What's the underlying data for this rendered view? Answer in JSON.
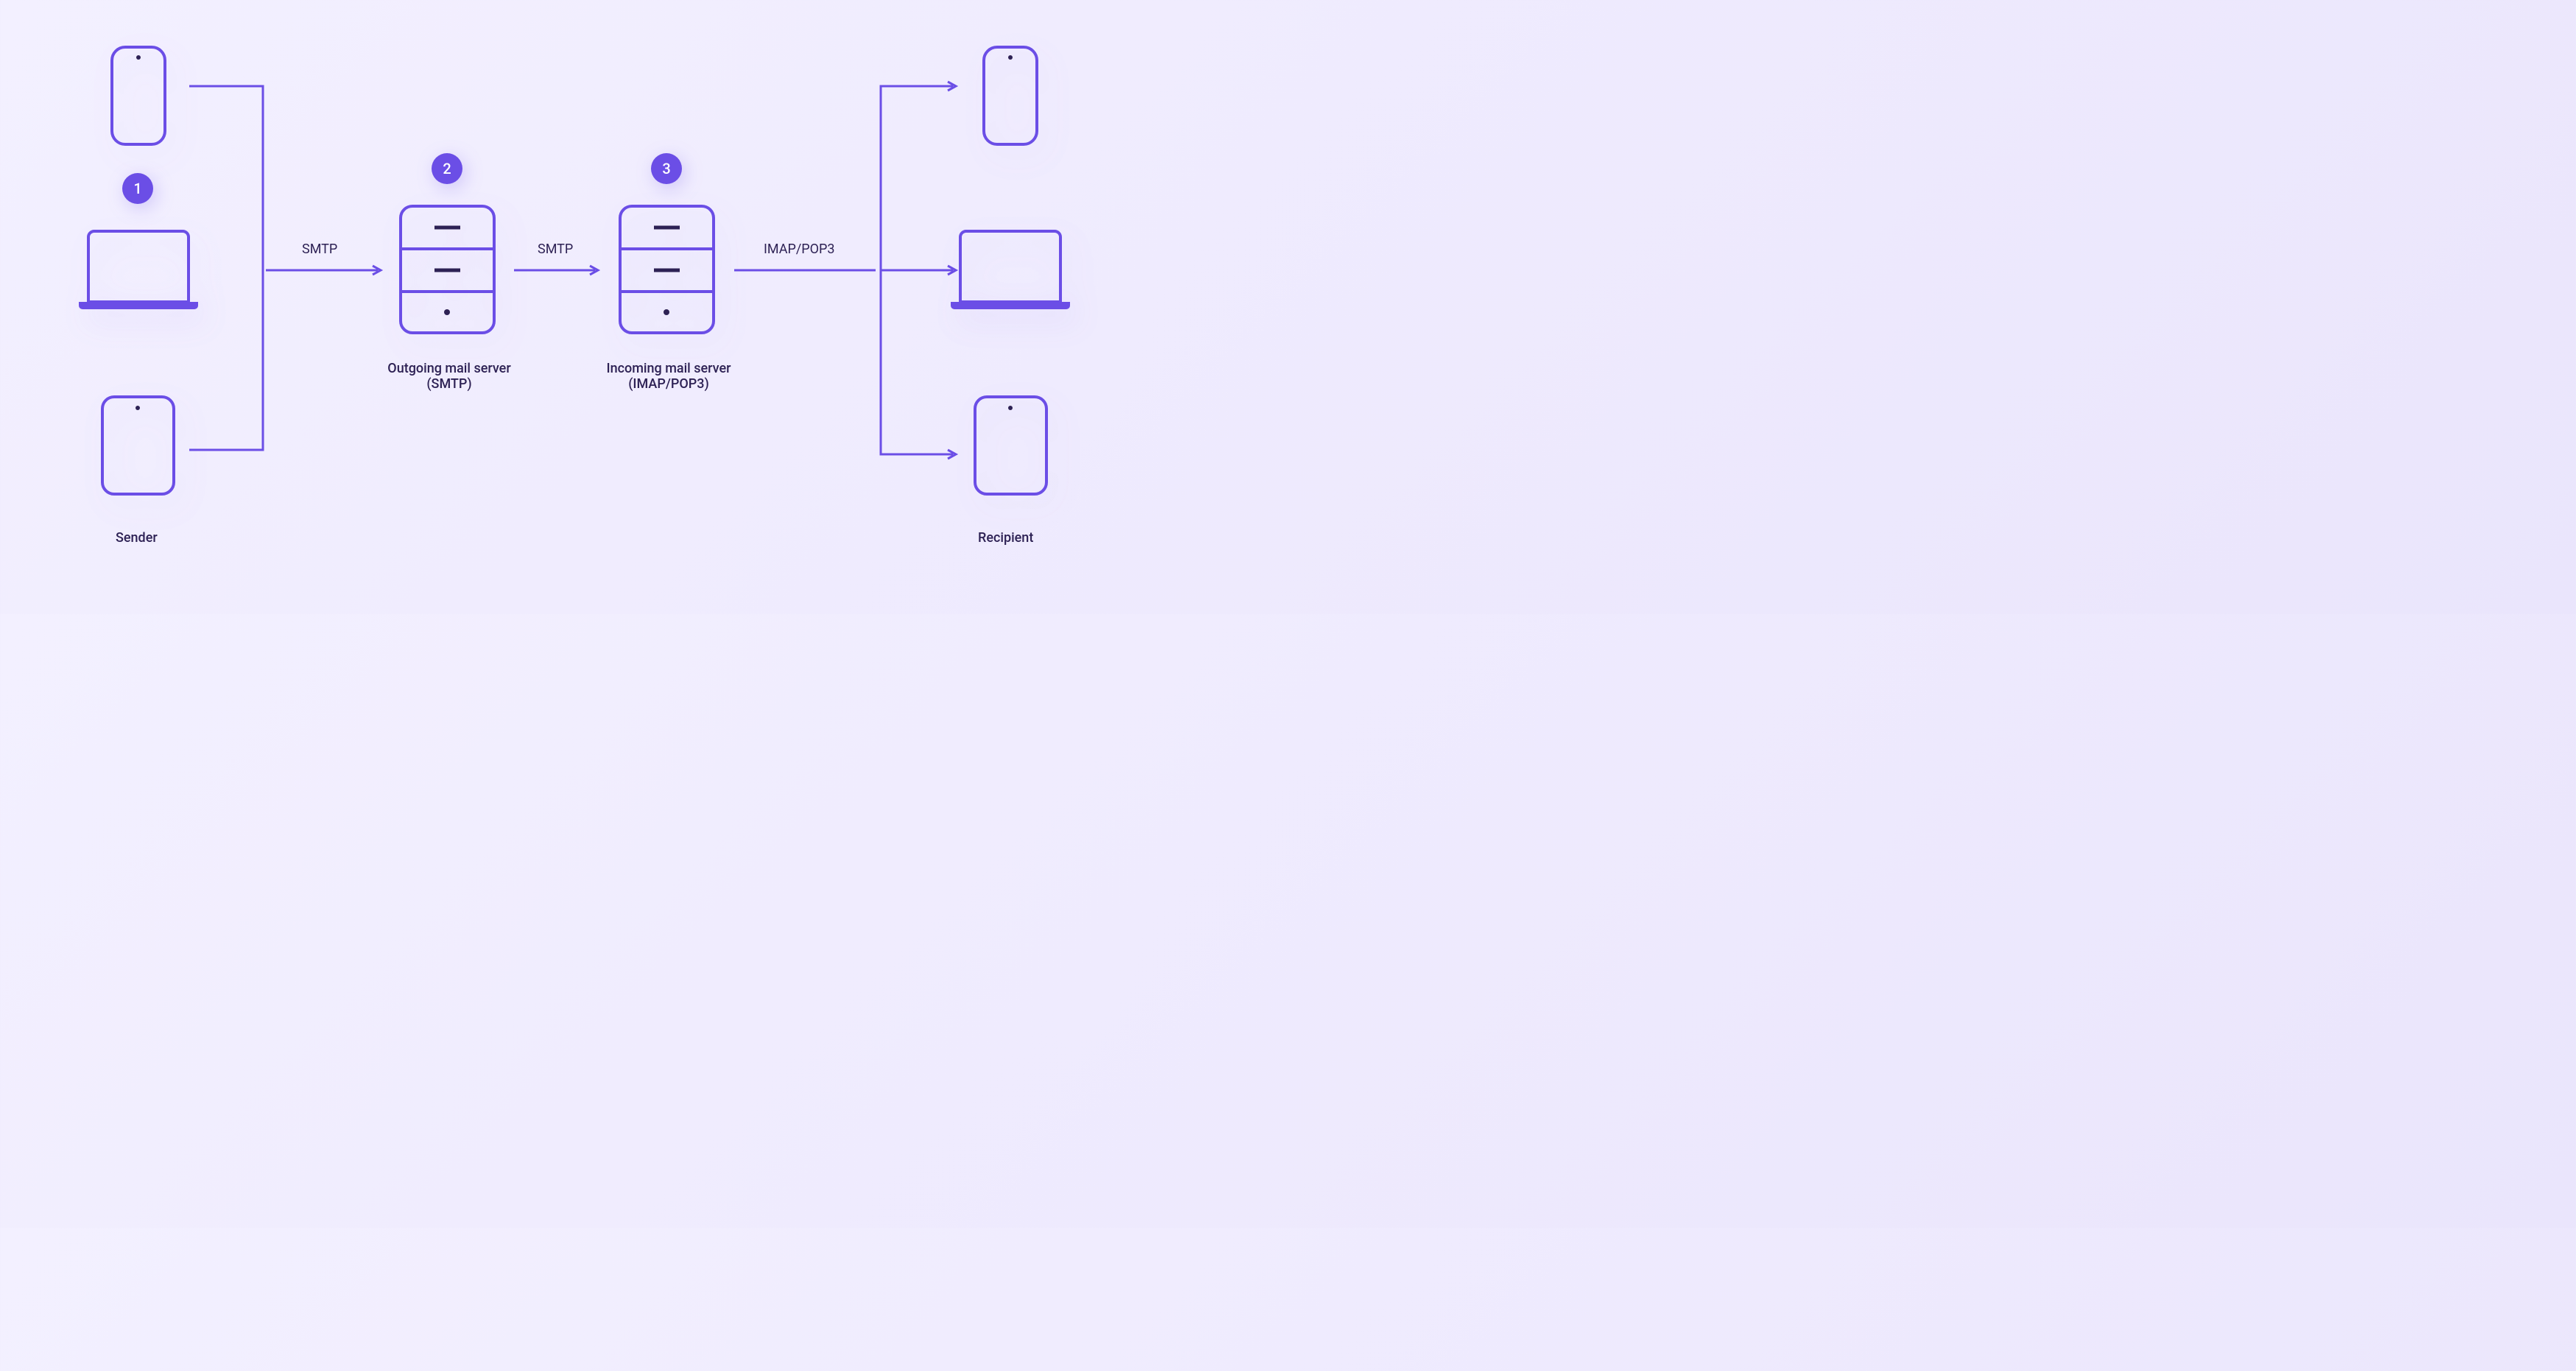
{
  "nodes": {
    "sender": {
      "label": "Sender",
      "badge": "1"
    },
    "outgoing_server": {
      "label_line1": "Outgoing mail server",
      "label_line2": "(SMTP)",
      "badge": "2"
    },
    "incoming_server": {
      "label_line1": "Incoming mail server",
      "label_line2": "(IMAP/POP3)",
      "badge": "3"
    },
    "recipient": {
      "label": "Recipient"
    }
  },
  "edges": {
    "sender_to_outgoing": "SMTP",
    "outgoing_to_incoming": "SMTP",
    "incoming_to_recipient": "IMAP/POP3"
  },
  "colors": {
    "accent": "#6B4EE6",
    "text": "#2d2154",
    "bg_light": "#f3f0ff",
    "bg_dark": "#eae5fc"
  }
}
